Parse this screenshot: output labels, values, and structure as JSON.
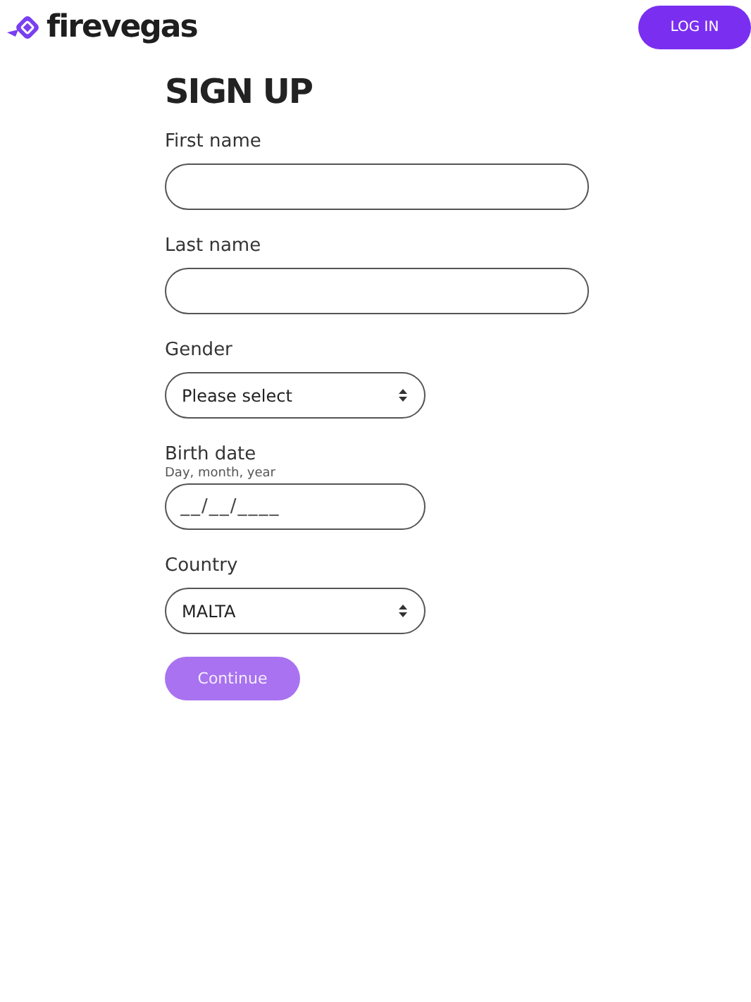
{
  "header": {
    "logo": "firevegas",
    "login_button": "LOG IN"
  },
  "form": {
    "title": "SIGN UP",
    "fields": [
      {
        "kind": "text",
        "label": "First name"
      },
      {
        "kind": "text",
        "label": "Last name"
      },
      {
        "kind": "select",
        "label": "Gender",
        "value": "Please select"
      },
      {
        "kind": "date",
        "label": "Birth date",
        "hint": "Day, month, year",
        "placeholder": "__/__/____"
      },
      {
        "kind": "select",
        "label": "Country",
        "value": "MALTA"
      }
    ],
    "continue_button": {
      "label": "Continue",
      "disabled": true
    }
  }
}
